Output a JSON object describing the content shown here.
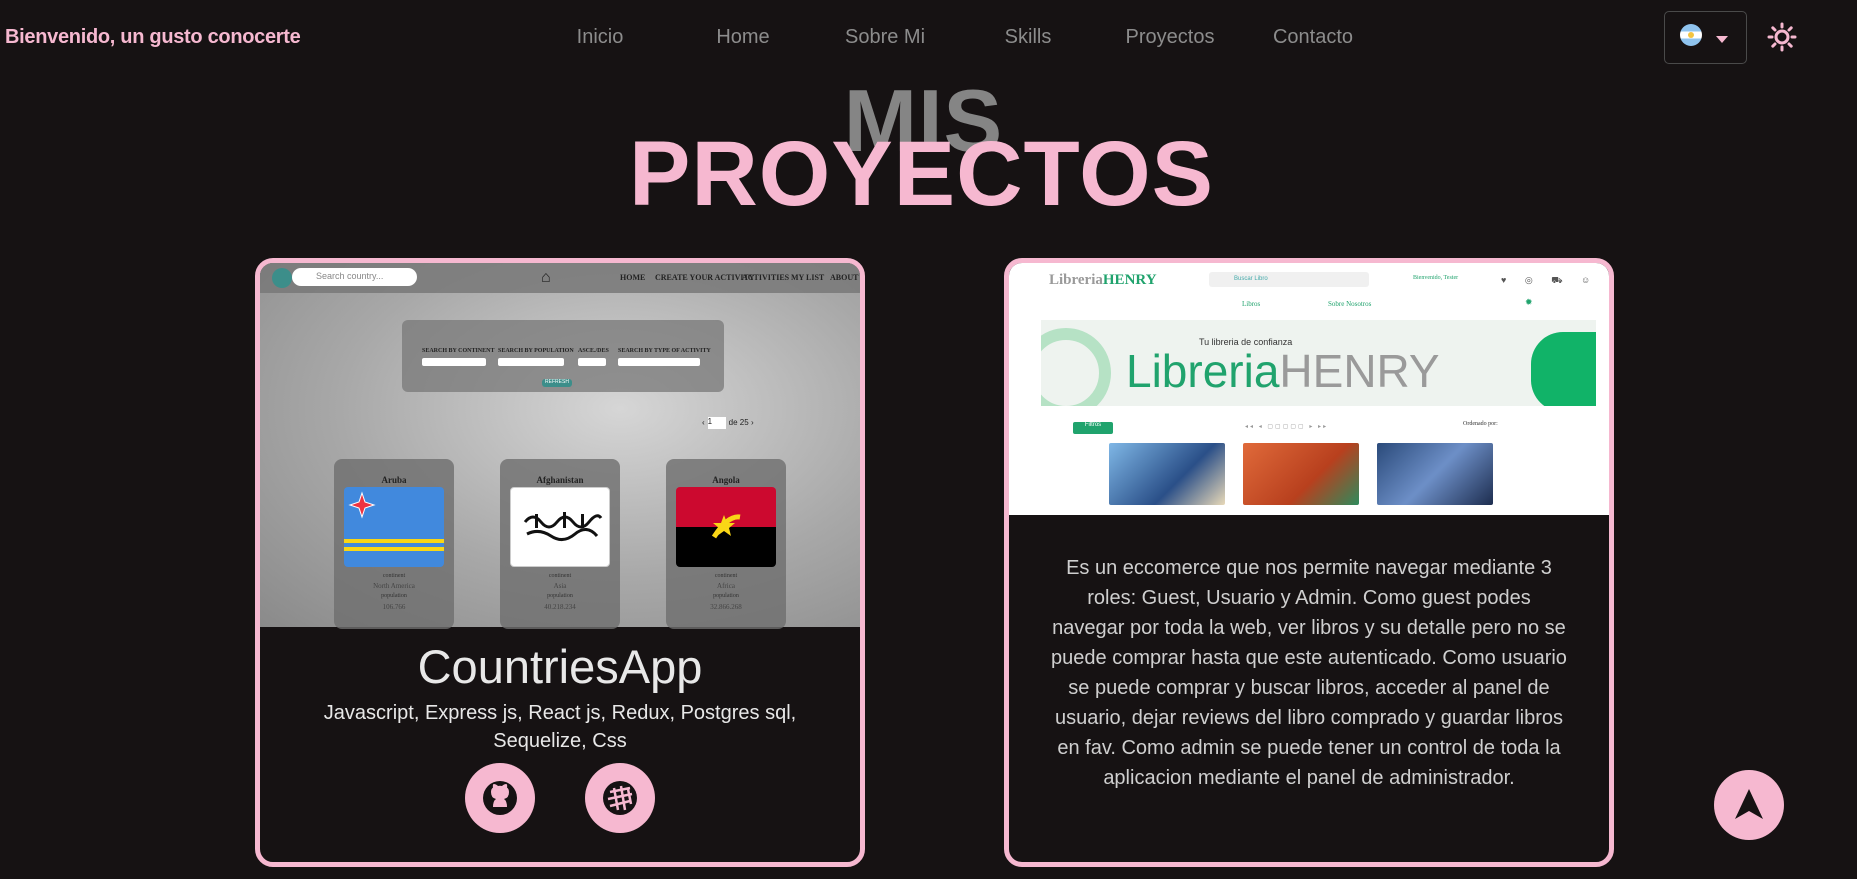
{
  "header": {
    "greeting": "Bienvenido, un gusto conocerte",
    "nav": [
      "Inicio",
      "Home",
      "Sobre Mi",
      "Skills",
      "Proyectos",
      "Contacto"
    ],
    "language_flag": "argentina-flag-icon",
    "theme_icon": "sun-icon"
  },
  "section": {
    "title_back": "MIS",
    "title_front": "PROYECTOS"
  },
  "projects": [
    {
      "title": "CountriesApp",
      "tech": "Javascript, Express js, React js, Redux, Postgres sql, Sequelize, Css",
      "screenshot": {
        "search_placeholder": "Search country...",
        "nav": [
          "HOME",
          "CREATE YOUR ACTIVITY",
          "ACTIVITIES",
          "MY LIST",
          "ABOUT"
        ],
        "filters": [
          "SEARCH BY CONTINENT",
          "SEARCH BY POPULATION",
          "ASCE./DES",
          "SEARCH BY TYPE OF ACTIVITY"
        ],
        "refresh": "REFRESH",
        "pager": "de 25",
        "page_value": "1",
        "countries": [
          {
            "name": "Aruba",
            "continent_label": "continent",
            "continent": "North America",
            "population_label": "population",
            "population": "106.766"
          },
          {
            "name": "Afghanistan",
            "continent_label": "continent",
            "continent": "Asia",
            "population_label": "population",
            "population": "40.218.234"
          },
          {
            "name": "Angola",
            "continent_label": "continent",
            "continent": "Africa",
            "population_label": "population",
            "population": "32.866.268"
          }
        ]
      },
      "links": [
        "github-icon",
        "website-icon"
      ]
    },
    {
      "screenshot": {
        "logo_a": "Libreria",
        "logo_b": "HENRY",
        "search_placeholder": "Buscar Libro",
        "welcome": "Bienvenido, Tester",
        "menu": [
          "Libros",
          "Sobre Nosotros"
        ],
        "banner_tag": "Tu libreria de confianza",
        "banner_a": "Libreria",
        "banner_b": "HENRY",
        "filter": "Filtros",
        "order": "Ordenado por:"
      },
      "description": "Es un eccomerce que nos permite navegar mediante 3 roles: Guest, Usuario y Admin. Como guest podes navegar por toda la web, ver libros y su detalle pero no se puede comprar hasta que este autenticado. Como usuario se puede comprar y buscar libros, acceder al panel de usuario, dejar reviews del libro comprado y guardar libros en fav. Como admin se puede tener un control de toda la aplicacion mediante el panel de administrador."
    }
  ],
  "colors": {
    "accent": "#f6b8d0",
    "background": "#161213",
    "muted": "#858585"
  },
  "scroll_top_icon": "arrow-up-icon"
}
